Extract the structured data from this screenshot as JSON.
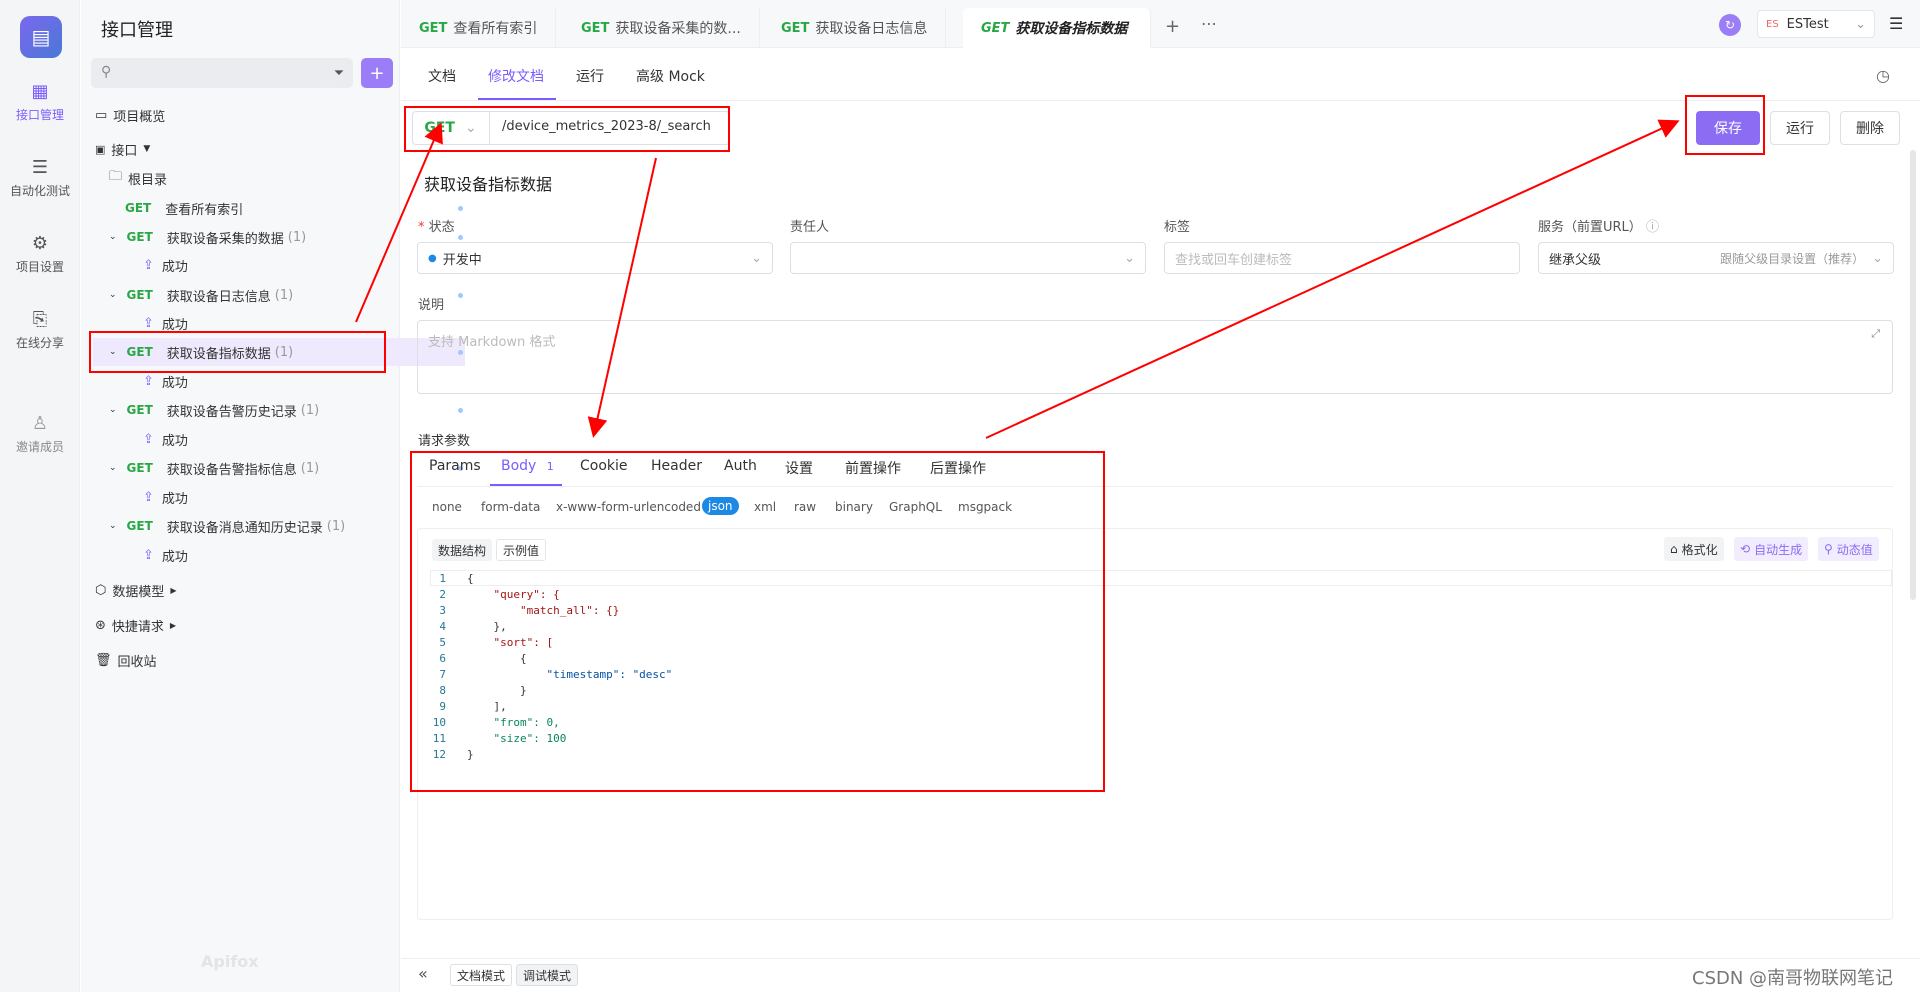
{
  "rail": {
    "items": [
      {
        "label": "接口管理",
        "icon": "api-icon"
      },
      {
        "label": "自动化测试",
        "icon": "layers-icon"
      },
      {
        "label": "项目设置",
        "icon": "gear-icon"
      },
      {
        "label": "在线分享",
        "icon": "share-icon"
      },
      {
        "label": "邀请成员",
        "icon": "user-add-icon"
      }
    ]
  },
  "sidebar": {
    "title": "接口管理",
    "search_placeholder": "",
    "overview": "项目概览",
    "api_group": "接口",
    "root": "根目录",
    "items": [
      {
        "method": "GET",
        "name": "查看所有索引",
        "count": ""
      },
      {
        "method": "GET",
        "name": "获取设备采集的数据",
        "count": "(1)",
        "child": "成功"
      },
      {
        "method": "GET",
        "name": "获取设备日志信息",
        "count": "(1)",
        "child": "成功"
      },
      {
        "method": "GET",
        "name": "获取设备指标数据",
        "count": "(1)",
        "child": "成功"
      },
      {
        "method": "GET",
        "name": "获取设备告警历史记录",
        "count": "(1)",
        "child": "成功"
      },
      {
        "method": "GET",
        "name": "获取设备告警指标信息",
        "count": "(1)",
        "child": "成功"
      },
      {
        "method": "GET",
        "name": "获取设备消息通知历史记录",
        "count": "(1)",
        "child": "成功"
      }
    ],
    "data_model": "数据模型",
    "quick_request": "快捷请求",
    "recycle": "回收站",
    "brand": "Apifox"
  },
  "tabs": [
    {
      "method": "GET",
      "label": "查看所有索引"
    },
    {
      "method": "GET",
      "label": "获取设备采集的数..."
    },
    {
      "method": "GET",
      "label": "获取设备日志信息"
    },
    {
      "method": "GET",
      "label": "获取设备指标数据"
    }
  ],
  "env": {
    "badge": "ES",
    "name": "ESTest"
  },
  "subtabs": [
    "文档",
    "修改文档",
    "运行",
    "高级 Mock"
  ],
  "request": {
    "method": "GET",
    "path": "/device_metrics_2023-8/_search",
    "save": "保存",
    "run": "运行",
    "delete": "删除"
  },
  "doc": {
    "title": "获取设备指标数据",
    "status_label": "状态",
    "status_value": "开发中",
    "owner_label": "责任人",
    "tags_label": "标签",
    "tags_placeholder": "查找或回车创建标签",
    "service_label": "服务（前置URL）",
    "service_value": "继承父级",
    "service_hint": "跟随父级目录设置（推荐）",
    "desc_label": "说明",
    "desc_placeholder": "支持 Markdown 格式"
  },
  "params": {
    "section_label": "请求参数",
    "tabs": [
      "Params",
      "Body",
      "Cookie",
      "Header",
      "Auth",
      "设置",
      "前置操作",
      "后置操作"
    ],
    "body_count": "1",
    "body_types": [
      "none",
      "form-data",
      "x-www-form-urlencoded",
      "json",
      "xml",
      "raw",
      "binary",
      "GraphQL",
      "msgpack"
    ],
    "view_tabs": [
      "数据结构",
      "示例值"
    ],
    "tools": [
      "格式化",
      "自动生成",
      "动态值"
    ]
  },
  "code": {
    "lines": [
      "{",
      "    \"query\": {",
      "        \"match_all\": {}",
      "    },",
      "    \"sort\": [",
      "        {",
      "            \"timestamp\": \"desc\"",
      "        }",
      "    ],",
      "    \"from\": 0,",
      "    \"size\": 100",
      "}"
    ]
  },
  "footer": {
    "doc_mode": "文档模式",
    "debug_mode": "调试模式",
    "watermark": "CSDN @南哥物联网笔记"
  },
  "colors": {
    "accent": "#7b5cff",
    "get": "#28a745",
    "annotation": "#ff0000"
  }
}
